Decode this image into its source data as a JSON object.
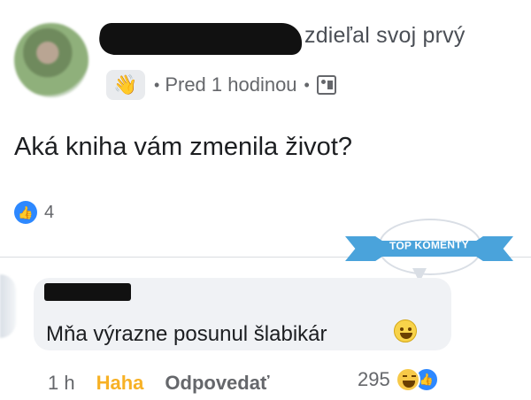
{
  "post": {
    "header": {
      "shared_text": "zdieľal svoj prvý",
      "time": "Pred 1 hodinou",
      "wave_icon": "waving-hand-icon",
      "audience_icon": "group-icon"
    },
    "text": "Aká kniha vám zmenila život?",
    "reactions": {
      "count": "4",
      "icon": "like-icon"
    },
    "badge": {
      "label": "TOP KOMENTY"
    }
  },
  "comment": {
    "text": "Mňa výrazne posunul šlabikár",
    "emoji": "grinning-face-icon",
    "actions": {
      "time": "1 h",
      "reaction": "Haha",
      "reply": "Odpovedať"
    },
    "reaction_summary": {
      "count": "295",
      "icons": [
        "haha-icon",
        "like-icon"
      ]
    }
  },
  "colors": {
    "facebook_blue": "#2d88ff",
    "haha_yellow": "#f7b125",
    "badge_blue": "#4aa3db",
    "bubble_gray": "#f0f2f5"
  }
}
